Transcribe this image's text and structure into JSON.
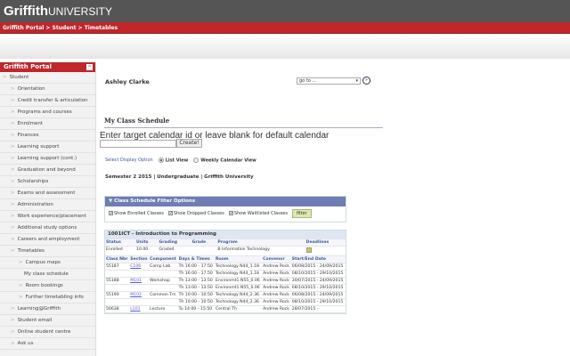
{
  "header": {
    "logo_main": "Griffith",
    "logo_sub": "UNIVERSITY"
  },
  "breadcrumb": "Griffith Portal > Student > Timetables",
  "sidebar": {
    "title": "Griffith Portal",
    "items": [
      {
        "label": "Student",
        "level": 0
      },
      {
        "label": "Orientation",
        "level": 1
      },
      {
        "label": "Credit transfer & articulation",
        "level": 1
      },
      {
        "label": "Programs and courses",
        "level": 1
      },
      {
        "label": "Enrolment",
        "level": 1
      },
      {
        "label": "Finances",
        "level": 1
      },
      {
        "label": "Learning support",
        "level": 1
      },
      {
        "label": "Learning support (cont.)",
        "level": 1
      },
      {
        "label": "Graduation and beyond",
        "level": 1
      },
      {
        "label": "Scholarships",
        "level": 1
      },
      {
        "label": "Exams and assessment",
        "level": 1
      },
      {
        "label": "Administration",
        "level": 1
      },
      {
        "label": "Work experience/placement",
        "level": 1
      },
      {
        "label": "Additional study options",
        "level": 1
      },
      {
        "label": "Careers and employment",
        "level": 1
      },
      {
        "label": "Timetables",
        "level": 1
      },
      {
        "label": "Campus maps",
        "level": 2
      },
      {
        "label": "My class schedule",
        "level": 2,
        "selected": true
      },
      {
        "label": "Room bookings",
        "level": 2
      },
      {
        "label": "Further timetabling info",
        "level": 2
      },
      {
        "label": "Learning@Griffith",
        "level": 1
      },
      {
        "label": "Student email",
        "level": 1
      },
      {
        "label": "Online student centre",
        "level": 1
      },
      {
        "label": "Ask us",
        "level": 1
      }
    ]
  },
  "main": {
    "user": "Ashley Clarke",
    "goto": "go to ...",
    "title": "My Class Schedule",
    "enter_prompt": "Enter target calendar id or leave blank for default calendar",
    "create_label": "Create!",
    "display_label": "Select Display Option",
    "list_view": "List View",
    "weekly_view": "Weekly Calendar View",
    "semester": "Semester 2 2015 | Undergraduate | Griffith University",
    "filter": {
      "title": "Class Schedule Filter Options",
      "enrolled": "Show Enrolled Classes",
      "dropped": "Show Dropped Classes",
      "waitlisted": "Show Waitlisted Classes",
      "button": "filter"
    },
    "course": {
      "title": "1001ICT - Introduction to Programming",
      "summary_headers": [
        "Status",
        "Units",
        "Grading",
        "Grade",
        "Program",
        "Deadlines"
      ],
      "summary": [
        "Enrolled",
        "10.00",
        "Graded",
        "",
        "B Information Technology"
      ],
      "headers": [
        "Class Nbr",
        "Section",
        "Component",
        "Days & Times",
        "Room",
        "Convenor",
        "Start/End Date"
      ],
      "rows": [
        [
          "55187",
          "C106",
          "Comp Lab",
          "Th 16:00 - 17:50",
          "Technology N44_1.18",
          "Andrew Rock",
          "06/08/2015 - 24/09/2015"
        ],
        [
          "",
          "",
          "",
          "Th 16:00 - 17:50",
          "Technology N44_1.18",
          "Andrew Rock",
          "08/10/2015 - 29/10/2015"
        ],
        [
          "55188",
          "M101",
          "Workshop",
          "Th 13:00 - 13:50",
          "Environmt1 N55_0.06",
          "Andrew Rock",
          "30/07/2015 - 24/09/2015"
        ],
        [
          "",
          "",
          "",
          "Th 13:00 - 13:50",
          "Environmt1 N55_0.06",
          "Andrew Rock",
          "08/10/2015 - 29/10/2015"
        ],
        [
          "55190",
          "M102",
          "Common Tm",
          "Th 10:00 - 10:50",
          "Technology N44_2.36",
          "Andrew Rock",
          "06/08/2015 - 24/09/2015"
        ],
        [
          "",
          "",
          "",
          "Th 10:00 - 10:50",
          "Technology N44_2.36",
          "Andrew Rock",
          "08/10/2015 - 29/10/2015"
        ],
        [
          "50638",
          "L101",
          "Lecture",
          "Tu 14:00 - 15:50",
          "Central Th",
          "Andrew Rock",
          "28/07/2015 -"
        ]
      ]
    }
  }
}
